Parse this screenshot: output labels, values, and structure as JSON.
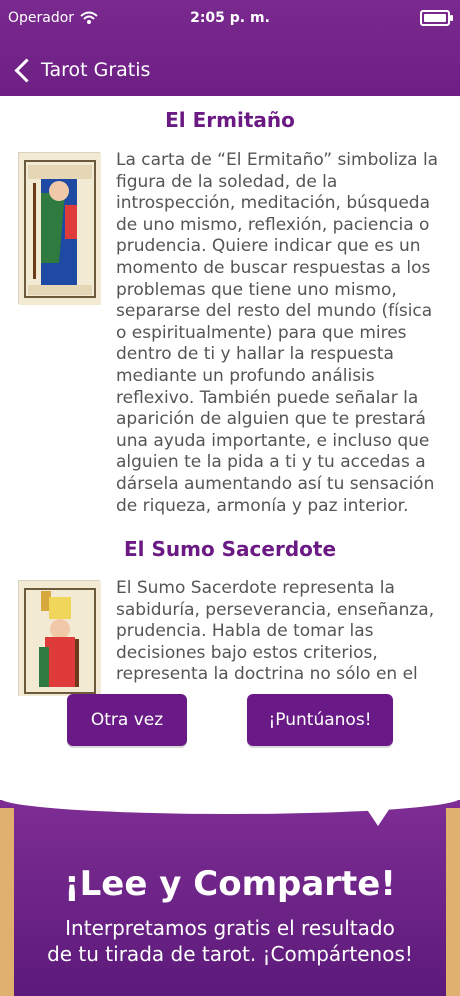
{
  "status_bar": {
    "carrier": "Operador",
    "time": "2:05 p. m.",
    "wifi_icon": "wifi-icon",
    "battery_icon": "battery-icon"
  },
  "nav": {
    "back_label": "Tarot Gratis",
    "back_icon": "chevron-left-icon"
  },
  "content": {
    "cards": [
      {
        "title": "El Ermitaño",
        "image_icon": "card-ermitano-image",
        "text": "La carta de “El Ermitaño” simboliza la figura de la soledad, de la introspección, meditación, búsqueda de uno mismo, reflexión, paciencia o prudencia. Quiere indicar que es un momento de buscar respuestas a los problemas que tiene uno mismo, separarse del resto del mundo (física o espiritualmente) para que mires dentro de ti y hallar la respuesta mediante un profundo análisis reflexivo. También puede señalar la aparición de alguien que te prestará una ayuda importante, e incluso que alguien te la pida a ti y tu accedas a dársela aumentando así tu sensación de riqueza, armonía y paz interior."
      },
      {
        "title": "El Sumo Sacerdote",
        "image_icon": "card-sumo-sacerdote-image",
        "text": "El Sumo Sacerdote representa la sabiduría, perseverancia, enseñanza, prudencia. Habla de tomar las decisiones bajo estos criterios, representa la doctrina no sólo en el"
      }
    ]
  },
  "actions": {
    "otra_vez": "Otra vez",
    "puntuanos": "¡Puntúanos!"
  },
  "promo": {
    "title": "¡Lee y Comparte!",
    "subtitle_line1": "Interpretamos gratis el resultado",
    "subtitle_line2": "de tu tirada de tarot. ¡Compártenos!"
  },
  "colors": {
    "brand_purple": "#6d1f84",
    "title_purple": "#6b1a84",
    "button_purple": "#6a1a86",
    "banner_gold": "#e0b16e"
  }
}
